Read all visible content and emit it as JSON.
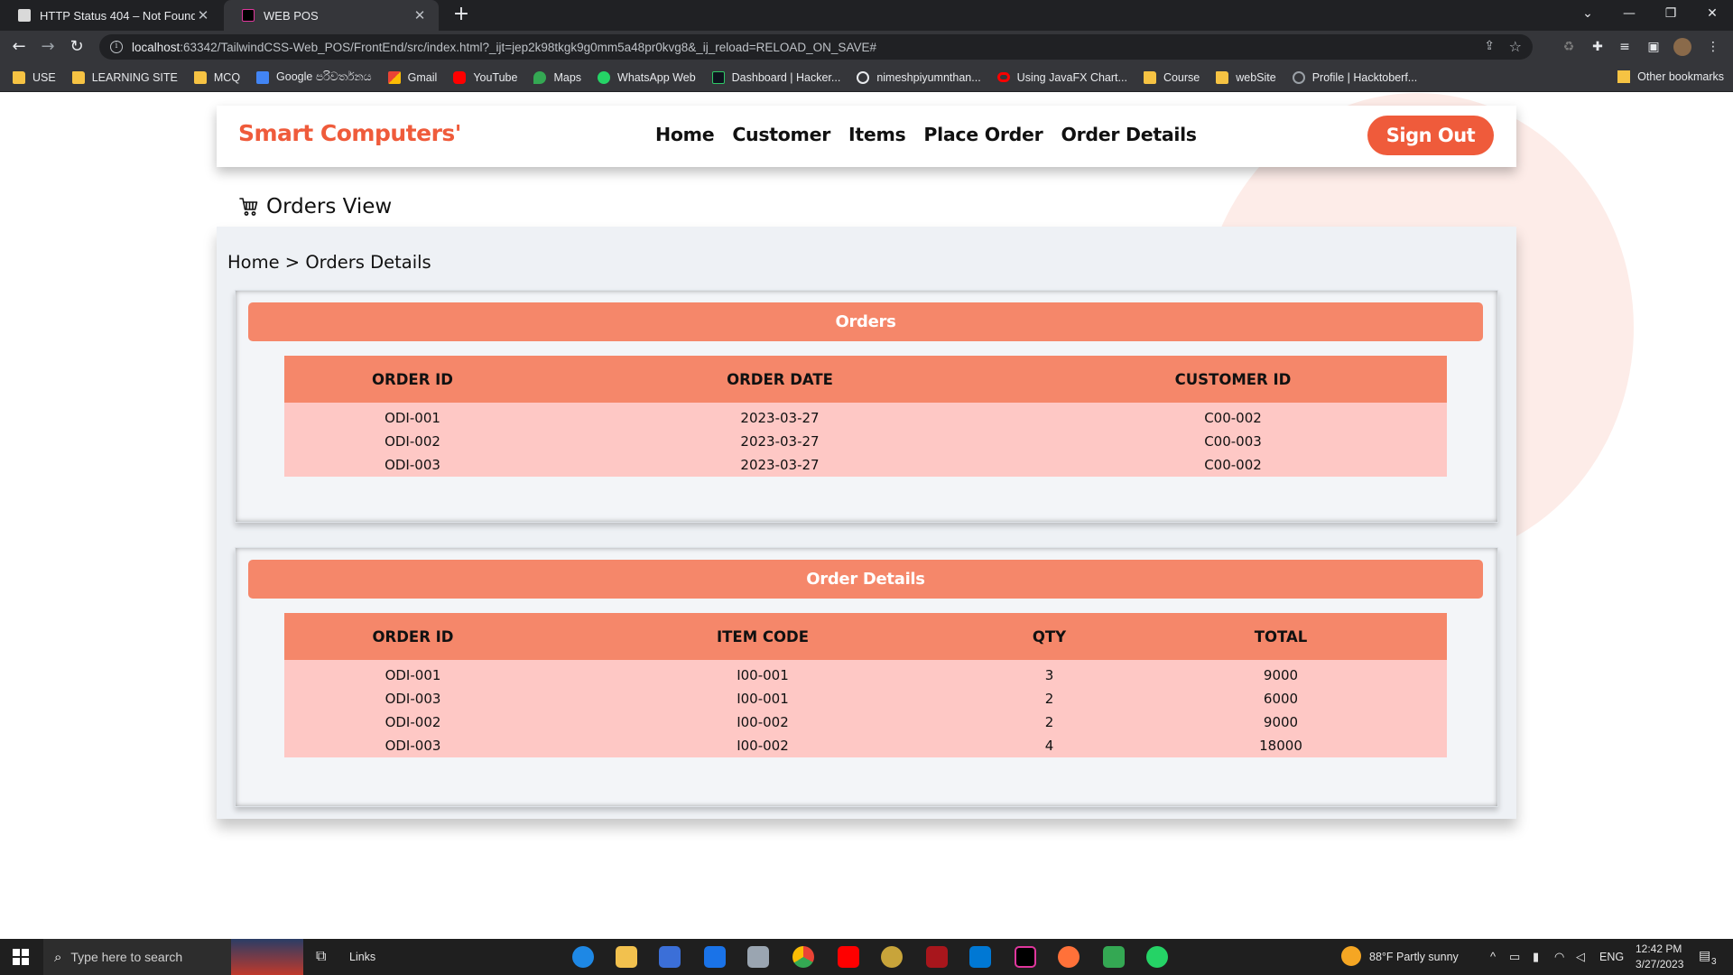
{
  "browser": {
    "tabs": [
      {
        "title": "HTTP Status 404 – Not Found",
        "active": false
      },
      {
        "title": "WEB POS",
        "active": true
      }
    ],
    "url_host": "localhost",
    "url_rest": ":63342/TailwindCSS-Web_POS/FrontEnd/src/index.html?_ijt=jep2k98tkgk9g0mm5a48pr0kvg8&_ij_reload=RELOAD_ON_SAVE#",
    "bookmarks": [
      {
        "label": "USE",
        "icon": "folder-icon"
      },
      {
        "label": "LEARNING SITE",
        "icon": "folder-icon"
      },
      {
        "label": "MCQ",
        "icon": "folder-icon"
      },
      {
        "label": "Google පරිවර්තනය",
        "icon": "google-translate-icon"
      },
      {
        "label": "Gmail",
        "icon": "gmail-icon"
      },
      {
        "label": "YouTube",
        "icon": "youtube-icon"
      },
      {
        "label": "Maps",
        "icon": "maps-icon"
      },
      {
        "label": "WhatsApp Web",
        "icon": "whatsapp-icon"
      },
      {
        "label": "Dashboard | Hacker...",
        "icon": "hackerrank-icon"
      },
      {
        "label": "nimeshpiyumnthan...",
        "icon": "github-icon"
      },
      {
        "label": "Using JavaFX Chart...",
        "icon": "oracle-icon"
      },
      {
        "label": "Course",
        "icon": "folder-icon"
      },
      {
        "label": "webSite",
        "icon": "folder-icon"
      },
      {
        "label": "Profile | Hacktoberf...",
        "icon": "hacktoberfest-icon"
      }
    ],
    "other_bookmarks": "Other bookmarks"
  },
  "app": {
    "brand": "Smart Computers'",
    "nav": [
      "Home",
      "Customer",
      "Items",
      "Place Order",
      "Order Details"
    ],
    "signout": "Sign Out",
    "view_title": "Orders View",
    "breadcrumb": "Home > Orders Details",
    "colors": {
      "accent": "#ef5b3b",
      "header": "#f5876a",
      "row": "#fec8c5"
    }
  },
  "orders": {
    "title": "Orders",
    "headers": [
      "ORDER ID",
      "ORDER DATE",
      "CUSTOMER ID"
    ],
    "rows": [
      [
        "ODI-001",
        "2023-03-27",
        "C00-002"
      ],
      [
        "ODI-002",
        "2023-03-27",
        "C00-003"
      ],
      [
        "ODI-003",
        "2023-03-27",
        "C00-002"
      ]
    ]
  },
  "order_details": {
    "title": "Order Details",
    "headers": [
      "ORDER ID",
      "ITEM CODE",
      "QTY",
      "TOTAL"
    ],
    "rows": [
      [
        "ODI-001",
        "I00-001",
        "3",
        "9000"
      ],
      [
        "ODI-003",
        "I00-001",
        "2",
        "6000"
      ],
      [
        "ODI-002",
        "I00-002",
        "2",
        "9000"
      ],
      [
        "ODI-003",
        "I00-002",
        "4",
        "18000"
      ]
    ]
  },
  "taskbar": {
    "search_placeholder": "Type here to search",
    "links": "Links",
    "weather": "88°F  Partly sunny",
    "lang": "ENG",
    "time": "12:42 PM",
    "date": "3/27/2023",
    "notifications": "3"
  }
}
